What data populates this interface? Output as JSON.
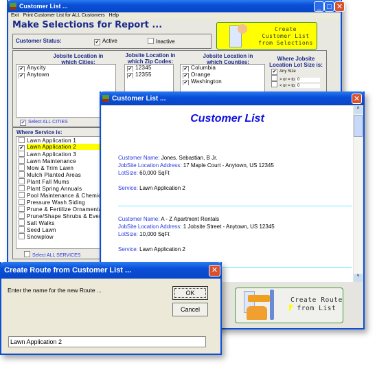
{
  "main": {
    "title": "Customer List ...",
    "menu": [
      "Exit",
      "Print Customer List for ALL Customers",
      "Help"
    ],
    "heading": "Make Selections for Report ...",
    "status_label": "Customer Status:",
    "active": "Active",
    "inactive": "Inactive",
    "create_button": [
      "Create",
      "Customer List",
      "from Selections"
    ],
    "cities_header": [
      "Jobsite Location in",
      "which Cities:"
    ],
    "cities": [
      "Anycity",
      "Anytown"
    ],
    "select_all_cities": "Select ALL CITIES",
    "zip_header": [
      "Jobsite Location in",
      "which Zip Codes:"
    ],
    "zips": [
      "12345",
      "12355"
    ],
    "counties_header": [
      "Jobsite Location in",
      "which Counties:"
    ],
    "counties": [
      "Columbia",
      "Orange",
      "Washington"
    ],
    "lot_header": [
      "Where Jobsite",
      "Location Lot Size is:"
    ],
    "lot_any": "Any Size",
    "lot_gte": "> or = to",
    "lot_gte_val": "0",
    "lot_lte": "< or = to",
    "lot_lte_val": "0",
    "service_header": "Where Service is:",
    "services": [
      "Lawn Application 1",
      "Lawn Application 2",
      "Lawn Application 3",
      "Lawn Maintenance",
      "Mow & Trim Lawn",
      "Mulch Planted Areas",
      "Plant Fall Mums",
      "Plant Spring Annuals",
      "Pool Maintenance & Chemicals",
      "Pressure Wash Siding",
      "Prune & Fertilize Ornamentals",
      "Prune/Shape Shrubs & Evergreens",
      "Salt Walks",
      "Seed Lawn",
      "Snowplow"
    ],
    "selected_service": "Lawn Application 2",
    "select_all_services": "Select ALL SERVICES"
  },
  "report": {
    "title": "Customer List ...",
    "heading": "Customer List",
    "labels": {
      "name": "Customer Name:",
      "address": "JobSite Location Address:",
      "lot": "LotSize:",
      "service": "Service:"
    },
    "records": [
      {
        "name": "Jones, Sebastian, B Jr.",
        "address": "17 Maple Court - Anytown, US 12345",
        "lot": "60,000 SqFt",
        "service": "Lawn Application 2"
      },
      {
        "name": "A - Z Apartment Rentals",
        "address": "1 Jobsite Street - Anytown, US 12345",
        "lot": "10,000 SqFt",
        "service": "Lawn Application 2"
      }
    ],
    "route_button": [
      "Create Route",
      "from List"
    ]
  },
  "dialog": {
    "title": "Create Route from Customer List ...",
    "prompt": "Enter the name for the new Route ...",
    "ok": "OK",
    "cancel": "Cancel",
    "value": "Lawn Application 2"
  },
  "colors": {
    "titlebar": "#0a4fd8",
    "highlight": "#ffff00",
    "label": "#2a3ad8",
    "heading": "#1a2a8a"
  }
}
